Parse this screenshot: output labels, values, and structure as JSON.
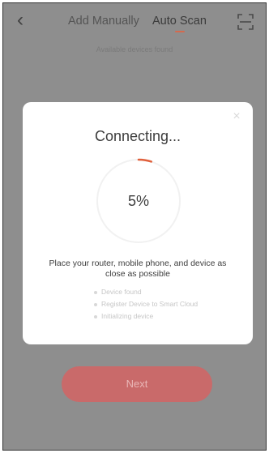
{
  "header": {
    "back_icon": "chevron-left-icon",
    "tabs": [
      {
        "label": "Add Manually",
        "active": false
      },
      {
        "label": "Auto Scan",
        "active": true
      }
    ],
    "scan_icon": "scan-frame-icon"
  },
  "subtitle": "Available devices found",
  "modal": {
    "close_icon": "close-icon",
    "title": "Connecting...",
    "progress": {
      "percent_label": "5%",
      "value": 0.05
    },
    "instruction": "Place your router, mobile phone, and device as close as possible",
    "steps": [
      "Device found",
      "Register Device to Smart Cloud",
      "Initializing device"
    ]
  },
  "next_button": "Next",
  "colors": {
    "accent": "#e0603c",
    "overlay_background": "#8e8e8e",
    "button_disabled": "#c96a6a"
  }
}
